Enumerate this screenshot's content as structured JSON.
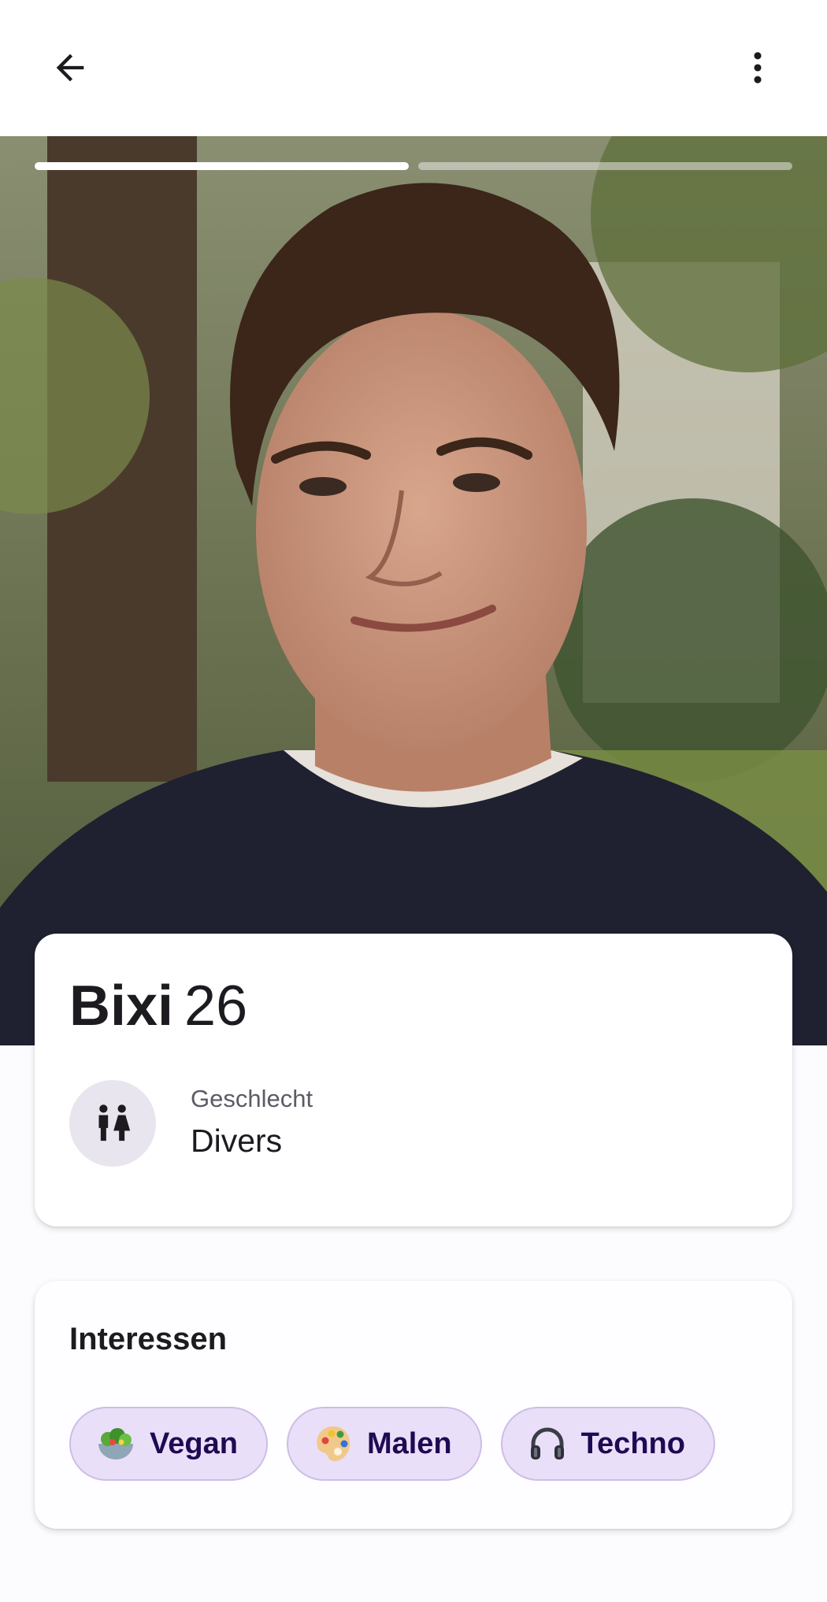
{
  "header": {
    "back_icon": "arrow-left-icon",
    "more_icon": "more-vertical-icon"
  },
  "photo": {
    "description_icon": "profile-photo",
    "progress": {
      "total": 2,
      "current": 1
    }
  },
  "profile": {
    "name": "Bixi",
    "age": "26",
    "gender_label": "Geschlecht",
    "gender_value": "Divers",
    "gender_icon": "gender-people-icon"
  },
  "interests": {
    "title": "Interessen",
    "items": [
      {
        "label": "Vegan",
        "icon": "salad-icon"
      },
      {
        "label": "Malen",
        "icon": "palette-icon"
      },
      {
        "label": "Techno",
        "icon": "headphones-icon"
      }
    ]
  },
  "colors": {
    "chip_bg": "#eadff9",
    "chip_border": "#cdbde6",
    "chip_text": "#1f0a52",
    "icon_circle": "#e9e5ee"
  }
}
